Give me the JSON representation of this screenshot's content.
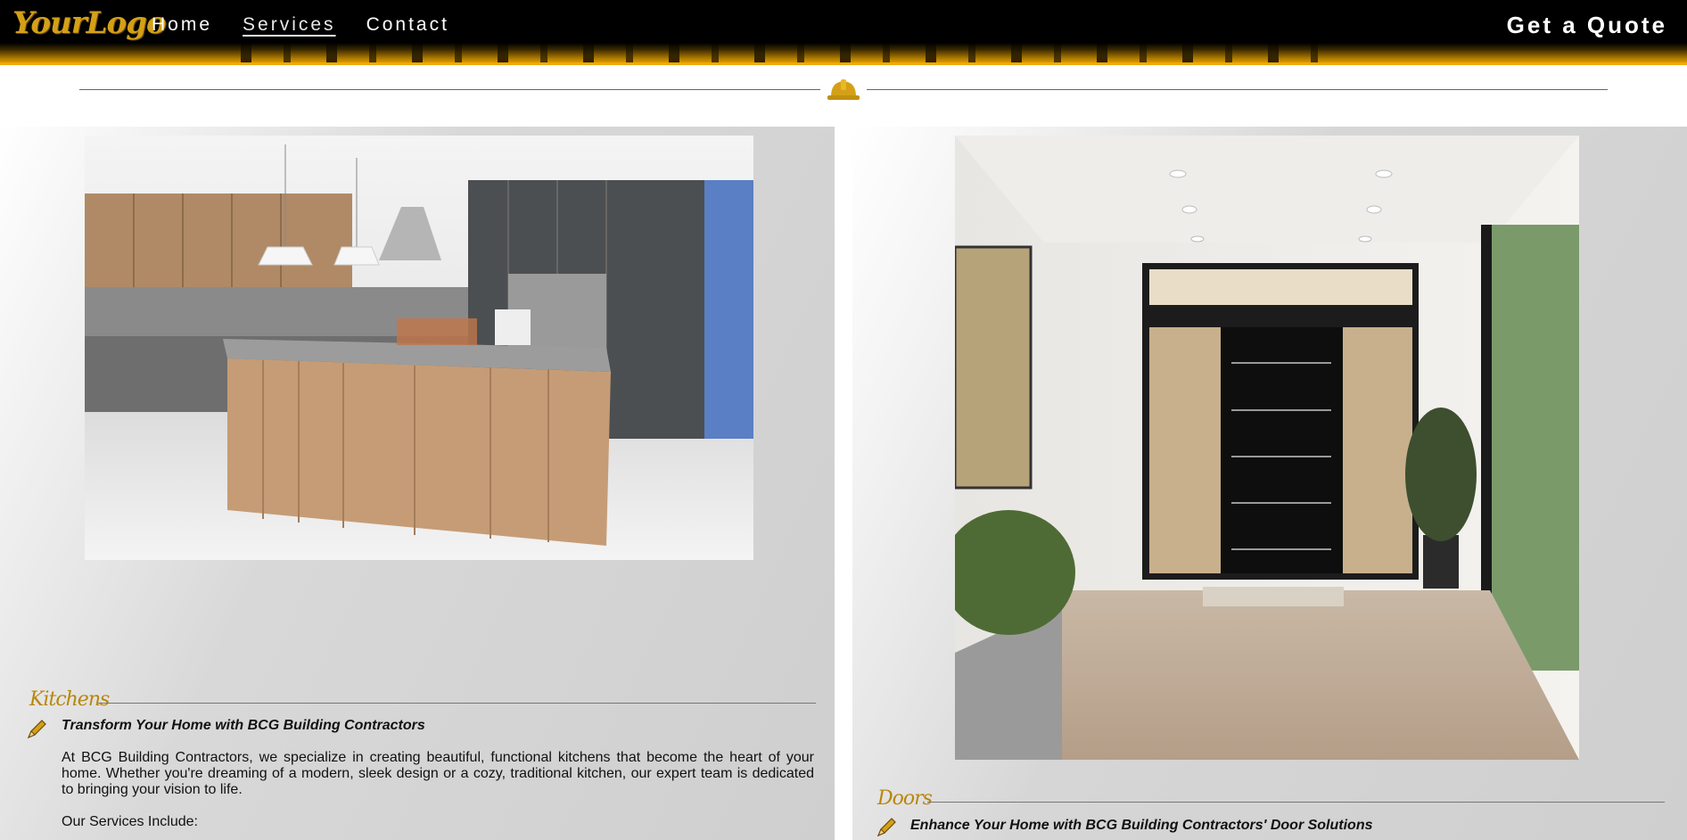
{
  "header": {
    "logo": "YourLogo",
    "nav": [
      {
        "label": "Home"
      },
      {
        "label": "Services"
      },
      {
        "label": "Contact"
      }
    ],
    "cta": "Get a Quote"
  },
  "divider": {
    "icon": "hard-hat-icon"
  },
  "kitchens": {
    "label": "Kitchens",
    "headline": "Transform Your Home with BCG Building Contractors",
    "paragraph": "At BCG Building Contractors, we specialize in creating beautiful, functional kitchens that become the heart of your home. Whether you're dreaming of a modern, sleek design or a cozy, traditional kitchen, our expert team is dedicated to bringing your vision to life.",
    "services_intro": "Our Services Include:"
  },
  "doors": {
    "label": "Doors",
    "headline": "Enhance Your Home with BCG Building Contractors' Door Solutions"
  },
  "colors": {
    "accent": "#f2a900",
    "gold": "#d4a017"
  }
}
